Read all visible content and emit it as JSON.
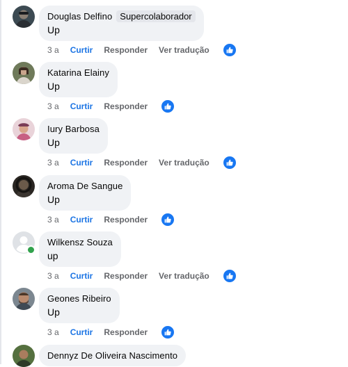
{
  "colors": {
    "accent": "#1877f2",
    "bubble": "#f0f2f5",
    "secondary_text": "#65676b"
  },
  "comments": [
    {
      "name": "Douglas Delfino",
      "badge": "Supercolaborador",
      "text": "Up",
      "time": "3 a",
      "like": "Curtir",
      "reply": "Responder",
      "translate": "Ver tradução",
      "reaction": "like-icon",
      "avatar": "photo"
    },
    {
      "name": "Katarina Elainy",
      "text": "Up",
      "time": "3 a",
      "like": "Curtir",
      "reply": "Responder",
      "reaction": "like-icon",
      "avatar": "photo"
    },
    {
      "name": "Iury Barbosa",
      "text": "Up",
      "time": "3 a",
      "like": "Curtir",
      "reply": "Responder",
      "translate": "Ver tradução",
      "reaction": "like-icon",
      "avatar": "photo"
    },
    {
      "name": "Aroma De Sangue",
      "text": "Up",
      "time": "3 a",
      "like": "Curtir",
      "reply": "Responder",
      "reaction": "like-icon",
      "avatar": "photo"
    },
    {
      "name": "Wilkensz Souza",
      "text": "up",
      "time": "3 a",
      "like": "Curtir",
      "reply": "Responder",
      "translate": "Ver tradução",
      "reaction": "like-icon",
      "avatar": "default-avatar",
      "online": true
    },
    {
      "name": "Geones Ribeiro",
      "text": "Up",
      "time": "3 a",
      "like": "Curtir",
      "reply": "Responder",
      "reaction": "like-icon",
      "avatar": "photo"
    },
    {
      "name": "Dennyz De Oliveira Nascimento",
      "avatar": "photo"
    }
  ]
}
